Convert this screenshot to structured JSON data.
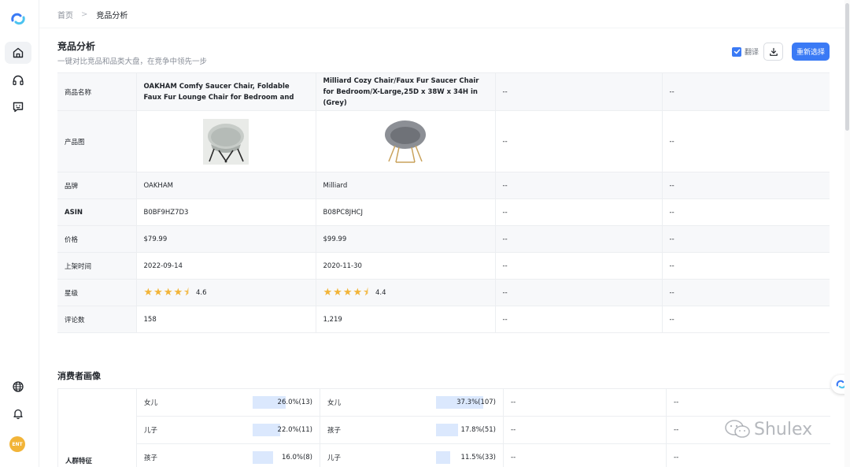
{
  "breadcrumb": {
    "home": "首页",
    "separator": ">",
    "current": "竞品分析"
  },
  "header": {
    "title": "竞品分析",
    "subtitle": "一键对比竞品和品类大盘，在竞争中领先一步",
    "translate_label": "翻译",
    "translate_checked": true,
    "download_icon": "download-icon",
    "reselect_label": "重新选择"
  },
  "sidebar": {
    "logo": "shulex-logo",
    "icons": [
      "home-icon",
      "headset-icon",
      "chat-smile-icon",
      "globe-icon",
      "bell-icon"
    ],
    "avatar_text": "ENT"
  },
  "colors": {
    "accent": "#3a7af5",
    "star": "#f2b438",
    "bar": "#dbe8fd"
  },
  "comparison": {
    "rows": [
      {
        "key": "商品名称",
        "values": [
          "OAKHAM Comfy Saucer Chair, Foldable Faux Fur Lounge Chair for Bedroom and Living Roo...",
          "Milliard Cozy Chair/Faux Fur Saucer Chair for Bedroom/X-Large,25D x 38W x 34H in (Grey)",
          "--",
          "--"
        ]
      },
      {
        "key": "产品图",
        "values": [
          "",
          "",
          "--",
          "--"
        ]
      },
      {
        "key": "品牌",
        "values": [
          "OAKHAM",
          "Milliard",
          "--",
          "--"
        ]
      },
      {
        "key": "ASIN",
        "values": [
          "B0BF9HZ7D3",
          "B08PC8JHCJ",
          "--",
          "--"
        ]
      },
      {
        "key": "价格",
        "values": [
          "$79.99",
          "$99.99",
          "--",
          "--"
        ]
      },
      {
        "key": "上架时间",
        "values": [
          "2022-09-14",
          "2020-11-30",
          "--",
          "--"
        ]
      },
      {
        "key": "星级",
        "values": [
          "4.6",
          "4.4",
          "--",
          "--"
        ]
      },
      {
        "key": "评论数",
        "values": [
          "158",
          "1,219",
          "--",
          "--"
        ]
      }
    ],
    "ratings": [
      4.6,
      4.4
    ]
  },
  "consumer": {
    "title": "消费者画像",
    "row_key": "人群特征",
    "rows": [
      {
        "a_label": "女儿",
        "a_pct": "26.0%(13)",
        "a_value": 26.0,
        "b_label": "女儿",
        "b_pct": "37.3%(107)",
        "b_value": 37.3,
        "c": "--",
        "d": "--"
      },
      {
        "a_label": "儿子",
        "a_pct": "22.0%(11)",
        "a_value": 22.0,
        "b_label": "孩子",
        "b_pct": "17.8%(51)",
        "b_value": 17.8,
        "c": "--",
        "d": "--"
      },
      {
        "a_label": "孩子",
        "a_pct": "16.0%(8)",
        "a_value": 16.0,
        "b_label": "儿子",
        "b_pct": "11.5%(33)",
        "b_value": 11.5,
        "c": "--",
        "d": "--"
      }
    ]
  },
  "watermark": "Shulex"
}
